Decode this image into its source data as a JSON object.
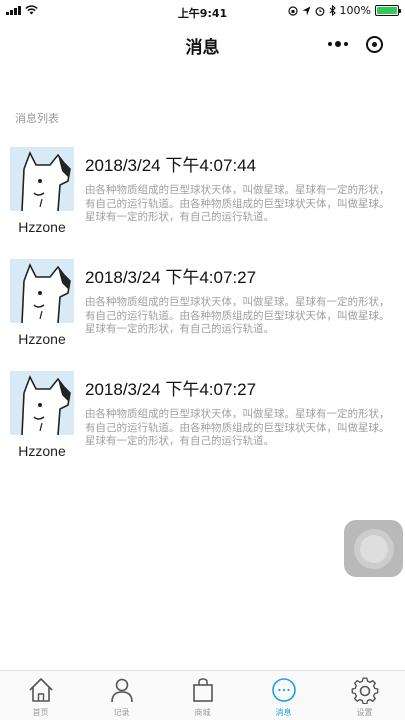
{
  "status_bar": {
    "time": "上午9:41",
    "battery": "100%"
  },
  "nav": {
    "title": "消息"
  },
  "section_label": "消息列表",
  "messages": [
    {
      "user": "Hzzone",
      "time": "2018/3/24 下午4:07:44",
      "text": "由各种物质组成的巨型球状天体，叫做星球。星球有一定的形状，有自己的运行轨道。由各种物质组成的巨型球状天体，叫做星球。星球有一定的形状，有自己的运行轨道。"
    },
    {
      "user": "Hzzone",
      "time": "2018/3/24 下午4:07:27",
      "text": "由各种物质组成的巨型球状天体，叫做星球。星球有一定的形状，有自己的运行轨道。由各种物质组成的巨型球状天体，叫做星球。星球有一定的形状，有自己的运行轨道。"
    },
    {
      "user": "Hzzone",
      "time": "2018/3/24 下午4:07:27",
      "text": "由各种物质组成的巨型球状天体，叫做星球。星球有一定的形状，有自己的运行轨道。由各种物质组成的巨型球状天体，叫做星球。星球有一定的形状，有自己的运行轨道。"
    }
  ],
  "tabs": [
    {
      "label": "首页",
      "icon": "home-icon",
      "active": false
    },
    {
      "label": "记录",
      "icon": "user-icon",
      "active": false
    },
    {
      "label": "商城",
      "icon": "shopping-bag-icon",
      "active": false
    },
    {
      "label": "消息",
      "icon": "message-icon",
      "active": true
    },
    {
      "label": "设置",
      "icon": "gear-icon",
      "active": false
    }
  ],
  "colors": {
    "accent": "#1ba1e6",
    "tab_inactive": "#999999",
    "avatar_bg": "#d9eaf7",
    "battery": "#34c759"
  }
}
